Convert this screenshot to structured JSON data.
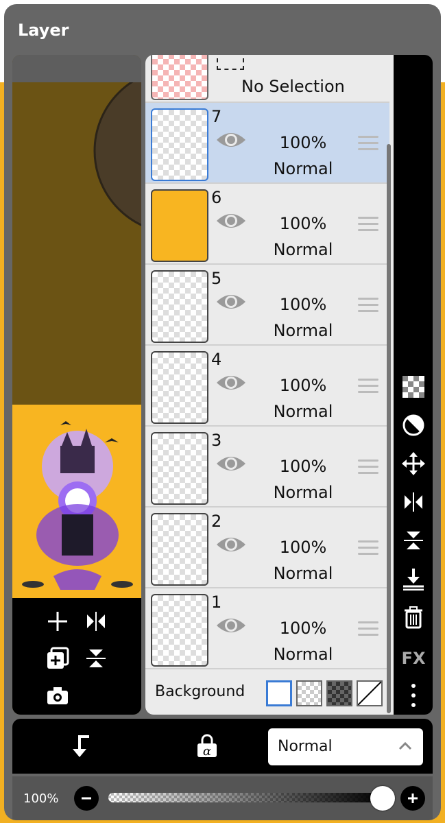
{
  "panel": {
    "title": "Layer"
  },
  "no_selection": {
    "label": "No Selection"
  },
  "layers": [
    {
      "number": "7",
      "opacity": "100%",
      "blend": "Normal",
      "selected": true,
      "thumb_bg": "#ffffff"
    },
    {
      "number": "6",
      "opacity": "100%",
      "blend": "Normal",
      "selected": false,
      "thumb_bg": "#f8b521"
    },
    {
      "number": "5",
      "opacity": "100%",
      "blend": "Normal",
      "selected": false,
      "thumb_bg": "#ffffff"
    },
    {
      "number": "4",
      "opacity": "100%",
      "blend": "Normal",
      "selected": false,
      "thumb_bg": "#ffffff"
    },
    {
      "number": "3",
      "opacity": "100%",
      "blend": "Normal",
      "selected": false,
      "thumb_bg": "#ffffff"
    },
    {
      "number": "2",
      "opacity": "100%",
      "blend": "Normal",
      "selected": false,
      "thumb_bg": "#ffffff"
    },
    {
      "number": "1",
      "opacity": "100%",
      "blend": "Normal",
      "selected": false,
      "thumb_bg": "#ffffff"
    }
  ],
  "background": {
    "label": "Background",
    "swatches": [
      "white",
      "transparent",
      "dark-checker",
      "none"
    ]
  },
  "right_toolbar": {
    "fx_label": "FX",
    "icons": [
      "checker-icon",
      "half-circle-icon",
      "move-icon",
      "flip-horizontal-icon",
      "flip-vertical-icon",
      "merge-down-icon",
      "trash-icon",
      "fx-icon",
      "more-icon"
    ]
  },
  "preview_tools": [
    "add-layer-icon",
    "flip-horizontal-icon",
    "duplicate-layer-icon",
    "flip-vertical-icon",
    "camera-icon"
  ],
  "bottom_bar": {
    "blend_mode": "Normal",
    "icons": [
      "clip-icon",
      "alpha-lock-icon"
    ]
  },
  "opacity_bar": {
    "label": "100%",
    "level": 1.0
  },
  "colors": {
    "accent": "#3a7bd5",
    "selected_row": "#c8d8ee",
    "thumb_orange": "#f8b521"
  }
}
